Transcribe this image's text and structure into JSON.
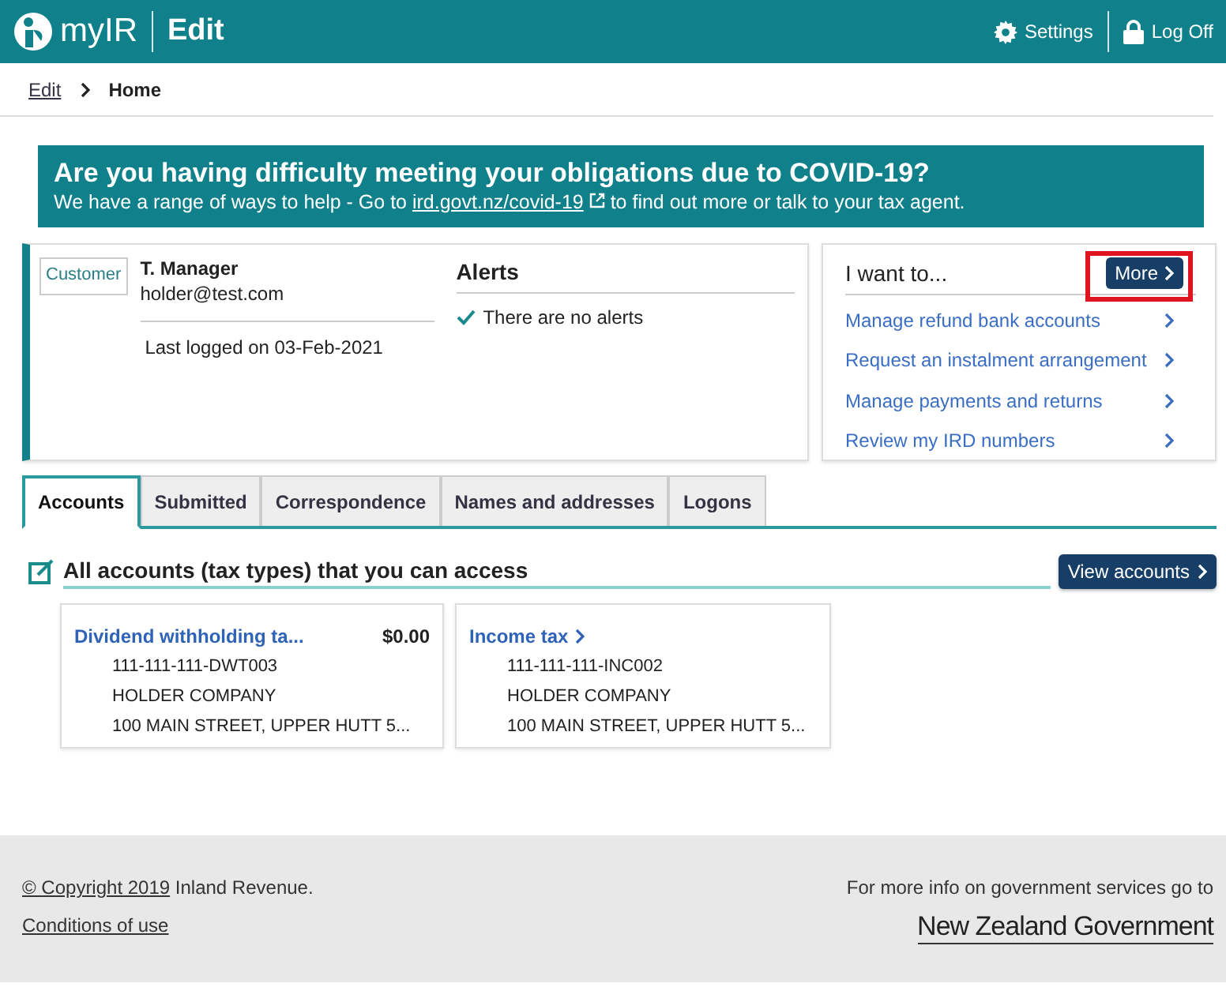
{
  "header": {
    "logo": "myIR",
    "section": "Edit",
    "settings": "Settings",
    "log_off": "Log Off"
  },
  "breadcrumb": [
    {
      "label": "Edit",
      "link": true
    },
    {
      "label": "Home",
      "link": false
    }
  ],
  "banner": {
    "title": "Are you having difficulty meeting your obligations due to COVID-19?",
    "text_before": "We have a range of ways to help - Go to ",
    "link": "ird.govt.nz/covid-19",
    "text_after": " to find out more or talk to your tax agent."
  },
  "profile": {
    "badge": "Customer",
    "name": "T. Manager",
    "email": "holder@test.com",
    "last_logged": "Last logged on 03-Feb-2021"
  },
  "alerts": {
    "title": "Alerts",
    "message": "There are no alerts"
  },
  "i_want_to": {
    "title": "I want to...",
    "more": "More",
    "highlighted": true,
    "items": [
      "Manage refund bank accounts",
      "Request an instalment arrangement",
      "Manage payments and returns",
      "Review my IRD numbers"
    ]
  },
  "tabs": [
    {
      "label": "Accounts",
      "selected": true
    },
    {
      "label": "Submitted",
      "selected": false
    },
    {
      "label": "Correspondence",
      "selected": false
    },
    {
      "label": "Names and addresses",
      "selected": false
    },
    {
      "label": "Logons",
      "selected": false
    }
  ],
  "accounts_section": {
    "title": "All accounts (tax types) that you can access",
    "button": "View accounts",
    "accounts": [
      {
        "name": "Dividend withholding ta...",
        "arrow": false,
        "amount": "$0.00",
        "number": "111-111-111-DWT003",
        "holder": "HOLDER COMPANY",
        "address": "100 MAIN STREET, UPPER HUTT 5..."
      },
      {
        "name": "Income tax",
        "arrow": true,
        "number": "111-111-111-INC002",
        "holder": "HOLDER COMPANY",
        "address": "100 MAIN STREET, UPPER HUTT 5..."
      }
    ]
  },
  "footer": {
    "copyright_link": "© Copyright 2019",
    "copyright_rest": " Inland Revenue.",
    "conditions": "Conditions of use",
    "gov_text": "For more info on government services go to",
    "gov_logo_first": "New Zealand",
    "gov_logo_second": "Government"
  }
}
